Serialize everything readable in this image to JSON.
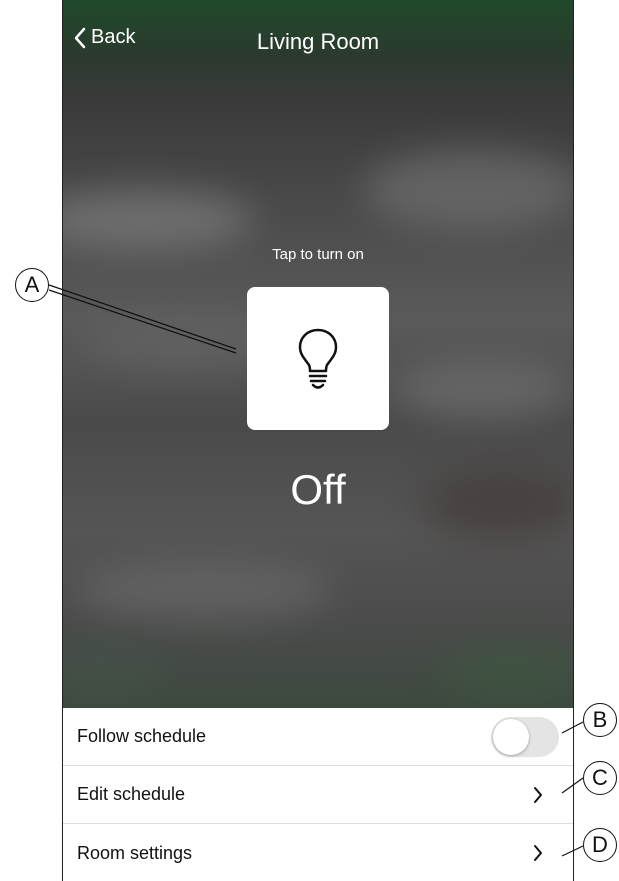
{
  "nav": {
    "back_label": "Back",
    "title": "Living Room"
  },
  "light": {
    "hint": "Tap to turn on",
    "state": "Off",
    "icon": "lightbulb-icon"
  },
  "settings": {
    "follow_schedule_label": "Follow schedule",
    "follow_schedule_on": false,
    "edit_schedule_label": "Edit schedule",
    "room_settings_label": "Room settings"
  },
  "callouts": {
    "a": "A",
    "b": "B",
    "c": "C",
    "d": "D"
  },
  "colors": {
    "header_green": "#1f4a2a",
    "toggle_off": "#e4e4e4",
    "text": "#111111"
  }
}
